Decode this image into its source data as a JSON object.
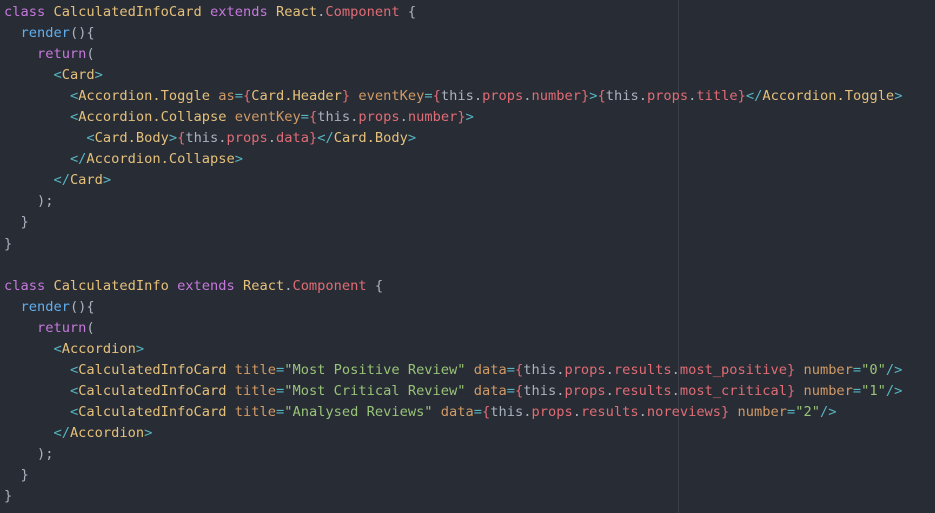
{
  "editor": {
    "colors": {
      "background": "#282c34",
      "ruler": "#3a3f4b",
      "keyword": "#c678dd",
      "class_name": "#e5c07b",
      "function": "#61afef",
      "tag": "#e06c75",
      "attribute": "#d19a66",
      "string": "#98c379",
      "punctuation": "#abb2bf",
      "bracket": "#56b6c2"
    },
    "lines": [
      {
        "tokens": [
          {
            "text": "class ",
            "kind": "keyword"
          },
          {
            "text": "CalculatedInfoCard ",
            "kind": "class_name"
          },
          {
            "text": "extends ",
            "kind": "keyword"
          },
          {
            "text": "React",
            "kind": "class_name"
          },
          {
            "text": ".",
            "kind": "punctuation"
          },
          {
            "text": "Component",
            "kind": "tag"
          },
          {
            "text": " {",
            "kind": "punctuation"
          }
        ]
      },
      {
        "tokens": [
          {
            "text": "  ",
            "kind": "punctuation"
          },
          {
            "text": "render",
            "kind": "function"
          },
          {
            "text": "(){",
            "kind": "punctuation"
          }
        ]
      },
      {
        "tokens": [
          {
            "text": "    ",
            "kind": "punctuation"
          },
          {
            "text": "return",
            "kind": "keyword"
          },
          {
            "text": "(",
            "kind": "punctuation"
          }
        ]
      },
      {
        "tokens": [
          {
            "text": "      ",
            "kind": "punctuation"
          },
          {
            "text": "<",
            "kind": "bracket"
          },
          {
            "text": "Card",
            "kind": "class_name"
          },
          {
            "text": ">",
            "kind": "bracket"
          }
        ]
      },
      {
        "tokens": [
          {
            "text": "        ",
            "kind": "punctuation"
          },
          {
            "text": "<",
            "kind": "bracket"
          },
          {
            "text": "Accordion.Toggle ",
            "kind": "class_name"
          },
          {
            "text": "as",
            "kind": "attribute"
          },
          {
            "text": "=",
            "kind": "bracket"
          },
          {
            "text": "{",
            "kind": "tag"
          },
          {
            "text": "Card.Header",
            "kind": "class_name"
          },
          {
            "text": "} ",
            "kind": "tag"
          },
          {
            "text": "eventKey",
            "kind": "attribute"
          },
          {
            "text": "=",
            "kind": "bracket"
          },
          {
            "text": "{",
            "kind": "tag"
          },
          {
            "text": "this",
            "kind": "punctuation"
          },
          {
            "text": ".",
            "kind": "punctuation"
          },
          {
            "text": "props",
            "kind": "tag"
          },
          {
            "text": ".",
            "kind": "punctuation"
          },
          {
            "text": "number",
            "kind": "tag"
          },
          {
            "text": "}",
            "kind": "tag"
          },
          {
            "text": ">",
            "kind": "bracket"
          },
          {
            "text": "{",
            "kind": "tag"
          },
          {
            "text": "this",
            "kind": "punctuation"
          },
          {
            "text": ".",
            "kind": "punctuation"
          },
          {
            "text": "props",
            "kind": "tag"
          },
          {
            "text": ".",
            "kind": "punctuation"
          },
          {
            "text": "title",
            "kind": "tag"
          },
          {
            "text": "}",
            "kind": "tag"
          },
          {
            "text": "</",
            "kind": "bracket"
          },
          {
            "text": "Accordion.Toggle",
            "kind": "class_name"
          },
          {
            "text": ">",
            "kind": "bracket"
          }
        ]
      },
      {
        "tokens": [
          {
            "text": "        ",
            "kind": "punctuation"
          },
          {
            "text": "<",
            "kind": "bracket"
          },
          {
            "text": "Accordion.Collapse ",
            "kind": "class_name"
          },
          {
            "text": "eventKey",
            "kind": "attribute"
          },
          {
            "text": "=",
            "kind": "bracket"
          },
          {
            "text": "{",
            "kind": "tag"
          },
          {
            "text": "this",
            "kind": "punctuation"
          },
          {
            "text": ".",
            "kind": "punctuation"
          },
          {
            "text": "props",
            "kind": "tag"
          },
          {
            "text": ".",
            "kind": "punctuation"
          },
          {
            "text": "number",
            "kind": "tag"
          },
          {
            "text": "}",
            "kind": "tag"
          },
          {
            "text": ">",
            "kind": "bracket"
          }
        ]
      },
      {
        "tokens": [
          {
            "text": "          ",
            "kind": "punctuation"
          },
          {
            "text": "<",
            "kind": "bracket"
          },
          {
            "text": "Card.Body",
            "kind": "class_name"
          },
          {
            "text": ">",
            "kind": "bracket"
          },
          {
            "text": "{",
            "kind": "tag"
          },
          {
            "text": "this",
            "kind": "punctuation"
          },
          {
            "text": ".",
            "kind": "punctuation"
          },
          {
            "text": "props",
            "kind": "tag"
          },
          {
            "text": ".",
            "kind": "punctuation"
          },
          {
            "text": "data",
            "kind": "tag"
          },
          {
            "text": "}",
            "kind": "tag"
          },
          {
            "text": "</",
            "kind": "bracket"
          },
          {
            "text": "Card.Body",
            "kind": "class_name"
          },
          {
            "text": ">",
            "kind": "bracket"
          }
        ]
      },
      {
        "tokens": [
          {
            "text": "        ",
            "kind": "punctuation"
          },
          {
            "text": "</",
            "kind": "bracket"
          },
          {
            "text": "Accordion.Collapse",
            "kind": "class_name"
          },
          {
            "text": ">",
            "kind": "bracket"
          }
        ]
      },
      {
        "tokens": [
          {
            "text": "      ",
            "kind": "punctuation"
          },
          {
            "text": "</",
            "kind": "bracket"
          },
          {
            "text": "Card",
            "kind": "class_name"
          },
          {
            "text": ">",
            "kind": "bracket"
          }
        ]
      },
      {
        "tokens": [
          {
            "text": "    );",
            "kind": "punctuation"
          }
        ]
      },
      {
        "tokens": [
          {
            "text": "  }",
            "kind": "punctuation"
          }
        ]
      },
      {
        "tokens": [
          {
            "text": "}",
            "kind": "punctuation"
          }
        ]
      },
      {
        "tokens": [
          {
            "text": "",
            "kind": "punctuation"
          }
        ]
      },
      {
        "tokens": [
          {
            "text": "class ",
            "kind": "keyword"
          },
          {
            "text": "CalculatedInfo ",
            "kind": "class_name"
          },
          {
            "text": "extends ",
            "kind": "keyword"
          },
          {
            "text": "React",
            "kind": "class_name"
          },
          {
            "text": ".",
            "kind": "punctuation"
          },
          {
            "text": "Component",
            "kind": "tag"
          },
          {
            "text": " {",
            "kind": "punctuation"
          }
        ]
      },
      {
        "tokens": [
          {
            "text": "  ",
            "kind": "punctuation"
          },
          {
            "text": "render",
            "kind": "function"
          },
          {
            "text": "(){",
            "kind": "punctuation"
          }
        ]
      },
      {
        "tokens": [
          {
            "text": "    ",
            "kind": "punctuation"
          },
          {
            "text": "return",
            "kind": "keyword"
          },
          {
            "text": "(",
            "kind": "punctuation"
          }
        ]
      },
      {
        "tokens": [
          {
            "text": "      ",
            "kind": "punctuation"
          },
          {
            "text": "<",
            "kind": "bracket"
          },
          {
            "text": "Accordion",
            "kind": "class_name"
          },
          {
            "text": ">",
            "kind": "bracket"
          }
        ]
      },
      {
        "tokens": [
          {
            "text": "        ",
            "kind": "punctuation"
          },
          {
            "text": "<",
            "kind": "bracket"
          },
          {
            "text": "CalculatedInfoCard ",
            "kind": "class_name"
          },
          {
            "text": "title",
            "kind": "attribute"
          },
          {
            "text": "=",
            "kind": "bracket"
          },
          {
            "text": "\"Most Positive Review\" ",
            "kind": "string"
          },
          {
            "text": "data",
            "kind": "attribute"
          },
          {
            "text": "=",
            "kind": "bracket"
          },
          {
            "text": "{",
            "kind": "tag"
          },
          {
            "text": "this",
            "kind": "punctuation"
          },
          {
            "text": ".",
            "kind": "punctuation"
          },
          {
            "text": "props",
            "kind": "tag"
          },
          {
            "text": ".",
            "kind": "punctuation"
          },
          {
            "text": "results",
            "kind": "tag"
          },
          {
            "text": ".",
            "kind": "punctuation"
          },
          {
            "text": "most_positive",
            "kind": "tag"
          },
          {
            "text": "} ",
            "kind": "tag"
          },
          {
            "text": "number",
            "kind": "attribute"
          },
          {
            "text": "=",
            "kind": "bracket"
          },
          {
            "text": "\"0\"",
            "kind": "string"
          },
          {
            "text": "/>",
            "kind": "bracket"
          }
        ]
      },
      {
        "tokens": [
          {
            "text": "        ",
            "kind": "punctuation"
          },
          {
            "text": "<",
            "kind": "bracket"
          },
          {
            "text": "CalculatedInfoCard ",
            "kind": "class_name"
          },
          {
            "text": "title",
            "kind": "attribute"
          },
          {
            "text": "=",
            "kind": "bracket"
          },
          {
            "text": "\"Most Critical Review\" ",
            "kind": "string"
          },
          {
            "text": "data",
            "kind": "attribute"
          },
          {
            "text": "=",
            "kind": "bracket"
          },
          {
            "text": "{",
            "kind": "tag"
          },
          {
            "text": "this",
            "kind": "punctuation"
          },
          {
            "text": ".",
            "kind": "punctuation"
          },
          {
            "text": "props",
            "kind": "tag"
          },
          {
            "text": ".",
            "kind": "punctuation"
          },
          {
            "text": "results",
            "kind": "tag"
          },
          {
            "text": ".",
            "kind": "punctuation"
          },
          {
            "text": "most_critical",
            "kind": "tag"
          },
          {
            "text": "} ",
            "kind": "tag"
          },
          {
            "text": "number",
            "kind": "attribute"
          },
          {
            "text": "=",
            "kind": "bracket"
          },
          {
            "text": "\"1\"",
            "kind": "string"
          },
          {
            "text": "/>",
            "kind": "bracket"
          }
        ]
      },
      {
        "tokens": [
          {
            "text": "        ",
            "kind": "punctuation"
          },
          {
            "text": "<",
            "kind": "bracket"
          },
          {
            "text": "CalculatedInfoCard ",
            "kind": "class_name"
          },
          {
            "text": "title",
            "kind": "attribute"
          },
          {
            "text": "=",
            "kind": "bracket"
          },
          {
            "text": "\"Analysed Reviews\" ",
            "kind": "string"
          },
          {
            "text": "data",
            "kind": "attribute"
          },
          {
            "text": "=",
            "kind": "bracket"
          },
          {
            "text": "{",
            "kind": "tag"
          },
          {
            "text": "this",
            "kind": "punctuation"
          },
          {
            "text": ".",
            "kind": "punctuation"
          },
          {
            "text": "props",
            "kind": "tag"
          },
          {
            "text": ".",
            "kind": "punctuation"
          },
          {
            "text": "results",
            "kind": "tag"
          },
          {
            "text": ".",
            "kind": "punctuation"
          },
          {
            "text": "noreviews",
            "kind": "tag"
          },
          {
            "text": "} ",
            "kind": "tag"
          },
          {
            "text": "number",
            "kind": "attribute"
          },
          {
            "text": "=",
            "kind": "bracket"
          },
          {
            "text": "\"2\"",
            "kind": "string"
          },
          {
            "text": "/>",
            "kind": "bracket"
          }
        ]
      },
      {
        "tokens": [
          {
            "text": "      ",
            "kind": "punctuation"
          },
          {
            "text": "</",
            "kind": "bracket"
          },
          {
            "text": "Accordion",
            "kind": "class_name"
          },
          {
            "text": ">",
            "kind": "bracket"
          }
        ]
      },
      {
        "tokens": [
          {
            "text": "    );",
            "kind": "punctuation"
          }
        ]
      },
      {
        "tokens": [
          {
            "text": "  }",
            "kind": "punctuation"
          }
        ]
      },
      {
        "tokens": [
          {
            "text": "}",
            "kind": "punctuation"
          }
        ]
      }
    ]
  }
}
